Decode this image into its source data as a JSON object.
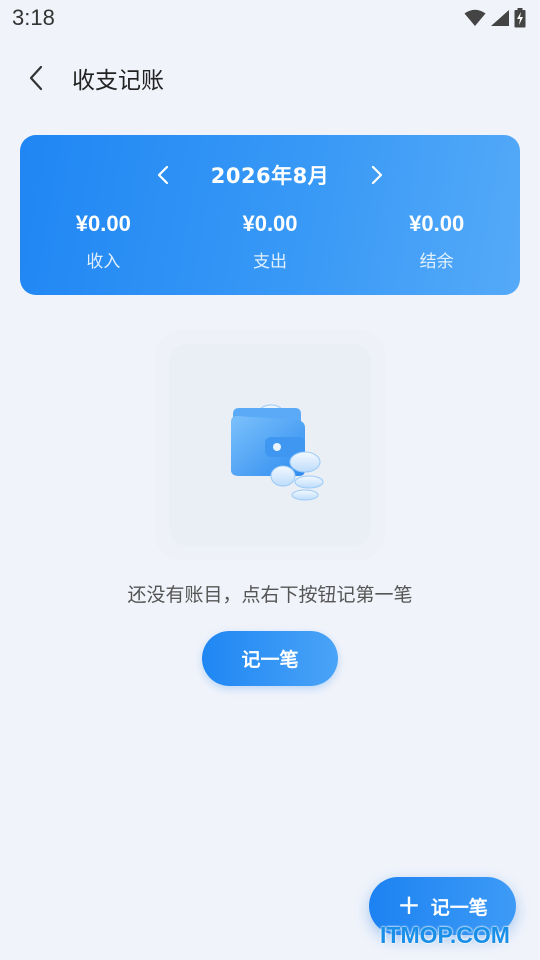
{
  "status_bar": {
    "time": "3:18"
  },
  "app_bar": {
    "title": "收支记账"
  },
  "summary": {
    "month": "2026年8月",
    "income": {
      "amount": "¥0.00",
      "label": "收入"
    },
    "expense": {
      "amount": "¥0.00",
      "label": "支出"
    },
    "balance": {
      "amount": "¥0.00",
      "label": "结余"
    }
  },
  "empty_state": {
    "message": "还没有账目，点右下按钮记第一笔",
    "button_label": "记一笔"
  },
  "fab": {
    "label": "记一笔"
  },
  "watermark": "ITMOP.COM",
  "colors": {
    "accent": "#1f86f3",
    "background": "#f0f3fa"
  }
}
